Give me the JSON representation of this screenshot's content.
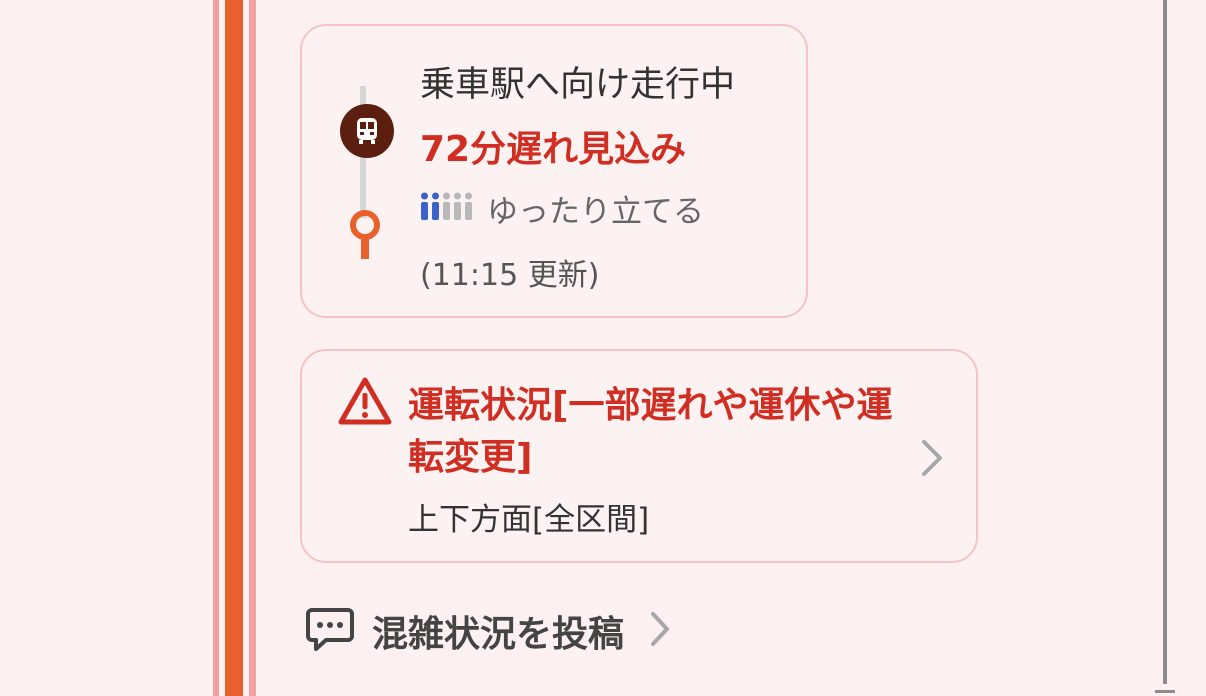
{
  "colors": {
    "background": "#fdf0f0",
    "route_line": "#e8602c",
    "route_line_outer": "#f0a0a0",
    "alert_red": "#d02e22",
    "train_icon_bg": "#5c1f0f",
    "crowd_active": "#3a62c8",
    "crowd_inactive": "#b8b8b8"
  },
  "train_status": {
    "heading": "乗車駅へ向け走行中",
    "delay": "72分遅れ見込み",
    "crowd_level": 2,
    "crowd_max": 5,
    "crowd_label": "ゆったり立てる",
    "updated": "(11:15 更新)",
    "train_icon": "train-icon",
    "station_icon": "station-pin-icon"
  },
  "service_alert": {
    "icon": "warning-icon",
    "title": "運転状況[一部遅れや運休や運転変更]",
    "subtitle": "上下方面[全区間]",
    "chevron": "chevron-right-icon"
  },
  "crowd_post": {
    "icon": "comment-icon",
    "label": "混雑状況を投稿",
    "chevron": "chevron-right-icon"
  }
}
